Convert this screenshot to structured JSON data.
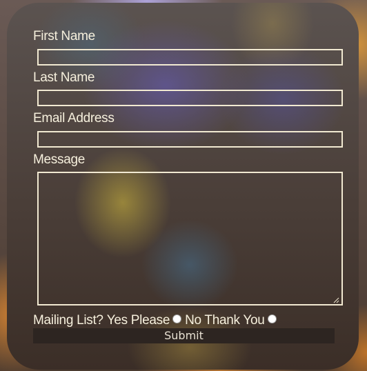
{
  "form": {
    "first_name_label": "First Name",
    "first_name_value": "",
    "last_name_label": "Last Name",
    "last_name_value": "",
    "email_label": "Email Address",
    "email_value": "",
    "message_label": "Message",
    "message_value": "",
    "mailing_list": {
      "label": "Mailing List?",
      "option_yes": "Yes Please",
      "option_no": "No Thank You",
      "selected": null
    },
    "submit_label": "Submit"
  },
  "colors": {
    "text": "#f6f0dd",
    "field_border": "#f2ead2",
    "submit_background": "#2d2521",
    "submit_text": "#e7e0d2"
  }
}
